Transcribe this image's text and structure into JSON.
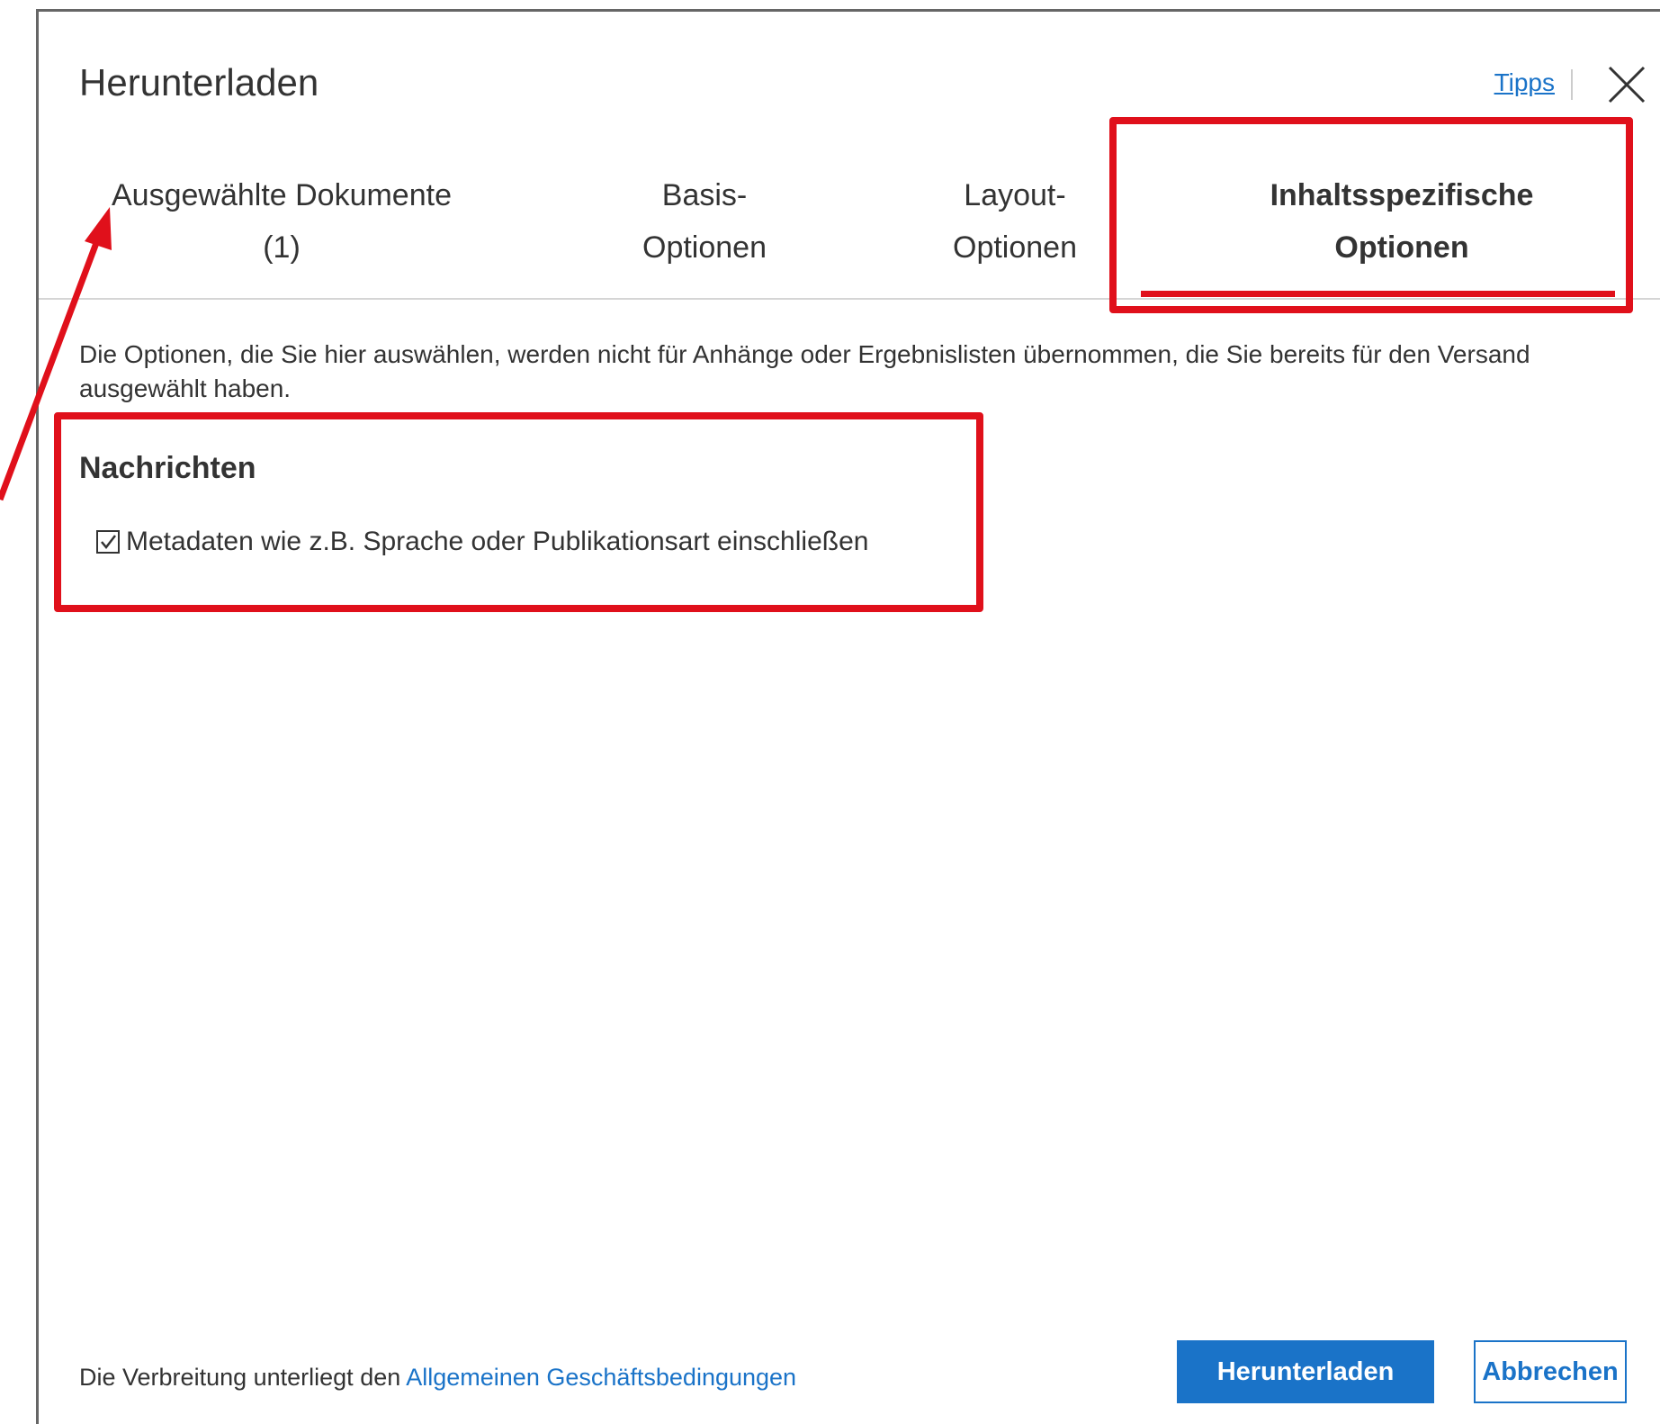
{
  "dialog": {
    "title": "Herunterladen",
    "tips_label": "Tipps",
    "close_icon": "close-icon"
  },
  "tabs": [
    {
      "line1": "Ausgewählte Dokumente",
      "line2": "(1)",
      "active": false
    },
    {
      "line1": "Basis-",
      "line2": "Optionen",
      "active": false
    },
    {
      "line1": "Layout-",
      "line2": "Optionen",
      "active": false
    },
    {
      "line1": "Inhaltsspezifische",
      "line2": "Optionen",
      "active": true
    }
  ],
  "content": {
    "intro": "Die Optionen, die Sie hier auswählen, werden nicht für Anhänge oder Ergebnislisten übernommen, die Sie bereits für den Versand ausgewählt haben.",
    "section_title": "Nachrichten",
    "option_label": "Metadaten wie z.B. Sprache oder Publikationsart einschließen",
    "option_checked": true
  },
  "footer": {
    "text_prefix": "Die Verbreitung unterliegt den ",
    "link_label": "Allgemeinen Geschäftsbedingungen",
    "primary_button": "Herunterladen",
    "secondary_button": "Abbrechen"
  },
  "colors": {
    "accent": "#1a73c8",
    "annotation": "#e0101b",
    "text": "#333333"
  }
}
